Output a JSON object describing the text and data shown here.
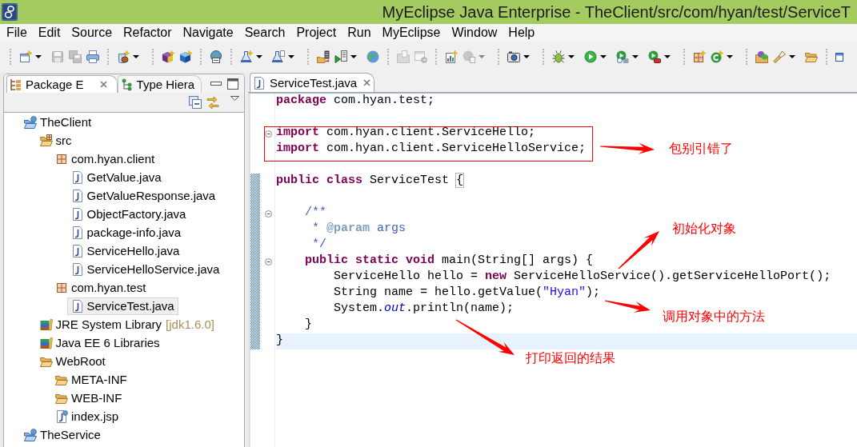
{
  "window": {
    "title": "MyEclipse Java Enterprise - TheClient/src/com/hyan/test/ServiceT"
  },
  "menu": [
    "File",
    "Edit",
    "Source",
    "Refactor",
    "Navigate",
    "Search",
    "Project",
    "Run",
    "MyEclipse",
    "Window",
    "Help"
  ],
  "toolbar": [
    [
      {
        "kind": "new-window",
        "disabled": false,
        "dropdown": true
      },
      {
        "kind": "save",
        "disabled": true,
        "dropdown": false
      },
      {
        "kind": "save-all",
        "disabled": true,
        "dropdown": false
      },
      {
        "kind": "print",
        "disabled": false,
        "dropdown": false
      }
    ],
    [
      {
        "kind": "new-jar",
        "disabled": false,
        "dropdown": true
      }
    ],
    [
      {
        "kind": "new-cube",
        "disabled": false,
        "dropdown": false
      },
      {
        "kind": "new-cube-alt",
        "disabled": false,
        "dropdown": false
      }
    ],
    [
      {
        "kind": "web-globe",
        "disabled": false,
        "dropdown": false
      }
    ],
    [
      {
        "kind": "flask-new",
        "disabled": false,
        "dropdown": true
      },
      {
        "kind": "flask-doc",
        "disabled": false,
        "dropdown": true
      }
    ],
    [
      {
        "kind": "deploy",
        "disabled": false,
        "dropdown": false
      },
      {
        "kind": "server-run",
        "disabled": false,
        "dropdown": true
      },
      {
        "kind": "browser",
        "disabled": false,
        "dropdown": false
      }
    ],
    [
      {
        "kind": "import",
        "disabled": true,
        "dropdown": false
      },
      {
        "kind": "export",
        "disabled": true,
        "dropdown": false
      }
    ],
    [
      {
        "kind": "report",
        "disabled": false,
        "dropdown": false
      },
      {
        "kind": "web-service",
        "disabled": true,
        "dropdown": true
      }
    ],
    [
      {
        "kind": "camera",
        "disabled": false,
        "dropdown": true
      }
    ],
    [
      {
        "kind": "debug",
        "disabled": false,
        "dropdown": true
      },
      {
        "kind": "run",
        "disabled": false,
        "dropdown": true
      },
      {
        "kind": "run-history",
        "disabled": false,
        "dropdown": true
      },
      {
        "kind": "tools",
        "disabled": false,
        "dropdown": true
      }
    ],
    [
      {
        "kind": "new-package",
        "disabled": false,
        "dropdown": false
      },
      {
        "kind": "new-class",
        "disabled": false,
        "dropdown": true
      }
    ],
    [
      {
        "kind": "open-type",
        "disabled": false,
        "dropdown": false
      },
      {
        "kind": "search",
        "disabled": false,
        "dropdown": true
      },
      {
        "kind": "open-folder",
        "disabled": false,
        "dropdown": false
      }
    ],
    [
      {
        "kind": "pin",
        "disabled": false,
        "dropdown": false
      }
    ]
  ],
  "explorer": {
    "tabs": [
      {
        "label": "Package E",
        "selected": true
      },
      {
        "label": "Type Hiera",
        "selected": false
      }
    ],
    "tree": [
      {
        "label": "TheClient",
        "kind": "project",
        "selected": false,
        "children": [
          {
            "label": "src",
            "kind": "source-folder",
            "selected": false,
            "children": [
              {
                "label": "com.hyan.client",
                "kind": "package",
                "selected": false,
                "children": [
                  {
                    "label": "GetValue.java",
                    "kind": "java-file",
                    "selected": false
                  },
                  {
                    "label": "GetValueResponse.java",
                    "kind": "java-file",
                    "selected": false
                  },
                  {
                    "label": "ObjectFactory.java",
                    "kind": "java-file",
                    "selected": false
                  },
                  {
                    "label": "package-info.java",
                    "kind": "java-file",
                    "selected": false
                  },
                  {
                    "label": "ServiceHello.java",
                    "kind": "java-file",
                    "selected": false
                  },
                  {
                    "label": "ServiceHelloService.java",
                    "kind": "java-file",
                    "selected": false
                  }
                ]
              },
              {
                "label": "com.hyan.test",
                "kind": "package",
                "selected": false,
                "children": [
                  {
                    "label": "ServiceTest.java",
                    "kind": "java-file",
                    "selected": true
                  }
                ]
              }
            ]
          },
          {
            "label": "JRE System Library",
            "qualifier": "[jdk1.6.0]",
            "kind": "library",
            "selected": false
          },
          {
            "label": "Java EE 6 Libraries",
            "kind": "library",
            "selected": false
          },
          {
            "label": "WebRoot",
            "kind": "folder",
            "selected": false,
            "children": [
              {
                "label": "META-INF",
                "kind": "folder",
                "selected": false
              },
              {
                "label": "WEB-INF",
                "kind": "folder",
                "selected": false
              },
              {
                "label": "index.jsp",
                "kind": "jsp-file",
                "selected": false
              }
            ]
          }
        ]
      },
      {
        "label": "TheService",
        "kind": "project",
        "selected": false
      }
    ]
  },
  "editor": {
    "tabs": [
      {
        "label": "ServiceTest.java",
        "selected": true
      }
    ],
    "lines": [
      {
        "tokens": [
          {
            "kind": "keyword",
            "text": "package"
          },
          {
            "kind": "plain",
            "text": " com.hyan.test;"
          }
        ],
        "foldable": false,
        "in_range": false,
        "boxed": false,
        "current": false
      },
      {
        "foldable": false,
        "in_range": false,
        "boxed": false,
        "current": false
      },
      {
        "tokens": [
          {
            "kind": "keyword",
            "text": "import"
          },
          {
            "kind": "plain",
            "text": " com.hyan.client.ServiceHello;"
          }
        ],
        "foldable": true,
        "in_range": false,
        "boxed": true,
        "current": false
      },
      {
        "tokens": [
          {
            "kind": "keyword",
            "text": "import"
          },
          {
            "kind": "plain",
            "text": " com.hyan.client.ServiceHelloService;"
          }
        ],
        "foldable": false,
        "in_range": false,
        "boxed": true,
        "current": false
      },
      {
        "foldable": false,
        "in_range": false,
        "boxed": false,
        "current": false
      },
      {
        "tokens": [
          {
            "kind": "keyword",
            "text": "public"
          },
          {
            "kind": "keyword",
            "text": " class"
          },
          {
            "kind": "plain",
            "text": " ServiceTest "
          },
          {
            "kind": "bracket",
            "text": "{"
          }
        ],
        "foldable": false,
        "in_range": true,
        "boxed": false,
        "current": false
      },
      {
        "foldable": false,
        "in_range": true,
        "boxed": false,
        "current": false
      },
      {
        "tokens": [
          {
            "kind": "comment",
            "text": "    /**"
          }
        ],
        "foldable": true,
        "in_range": true,
        "boxed": false,
        "current": false
      },
      {
        "tokens": [
          {
            "kind": "comment",
            "text": "     * "
          },
          {
            "kind": "doctag",
            "text": "@param"
          },
          {
            "kind": "comment",
            "text": " args"
          }
        ],
        "foldable": false,
        "in_range": true,
        "boxed": false,
        "current": false
      },
      {
        "tokens": [
          {
            "kind": "comment",
            "text": "     */"
          }
        ],
        "foldable": false,
        "in_range": true,
        "boxed": false,
        "current": false
      },
      {
        "tokens": [
          {
            "kind": "keyword",
            "text": "    public"
          },
          {
            "kind": "keyword",
            "text": " static"
          },
          {
            "kind": "keyword",
            "text": " void"
          },
          {
            "kind": "plain",
            "text": " main(String[] args) {"
          }
        ],
        "foldable": true,
        "in_range": true,
        "boxed": false,
        "current": false
      },
      {
        "tokens": [
          {
            "kind": "plain",
            "text": "        ServiceHello hello = "
          },
          {
            "kind": "keyword",
            "text": "new"
          },
          {
            "kind": "plain",
            "text": " ServiceHelloService().getServiceHelloPort();"
          }
        ],
        "foldable": false,
        "in_range": true,
        "boxed": false,
        "current": false
      },
      {
        "tokens": [
          {
            "kind": "plain",
            "text": "        String name = hello.getValue("
          },
          {
            "kind": "string",
            "text": "\"Hyan\""
          },
          {
            "kind": "plain",
            "text": ");"
          }
        ],
        "foldable": false,
        "in_range": true,
        "boxed": false,
        "current": false
      },
      {
        "tokens": [
          {
            "kind": "plain",
            "text": "        System."
          },
          {
            "kind": "field",
            "text": "out"
          },
          {
            "kind": "plain",
            "text": ".println(name);"
          }
        ],
        "foldable": false,
        "in_range": true,
        "boxed": false,
        "current": false
      },
      {
        "tokens": [
          {
            "kind": "plain",
            "text": "    }"
          }
        ],
        "foldable": false,
        "in_range": true,
        "boxed": false,
        "current": false
      },
      {
        "tokens": [
          {
            "kind": "plain",
            "text": "}"
          }
        ],
        "foldable": false,
        "in_range": true,
        "boxed": false,
        "current": true
      }
    ]
  },
  "annotations": [
    {
      "text": "包别引错了"
    },
    {
      "text": "初始化对象"
    },
    {
      "text": "调用对象中的方法"
    },
    {
      "text": "打印返回的结果"
    }
  ]
}
